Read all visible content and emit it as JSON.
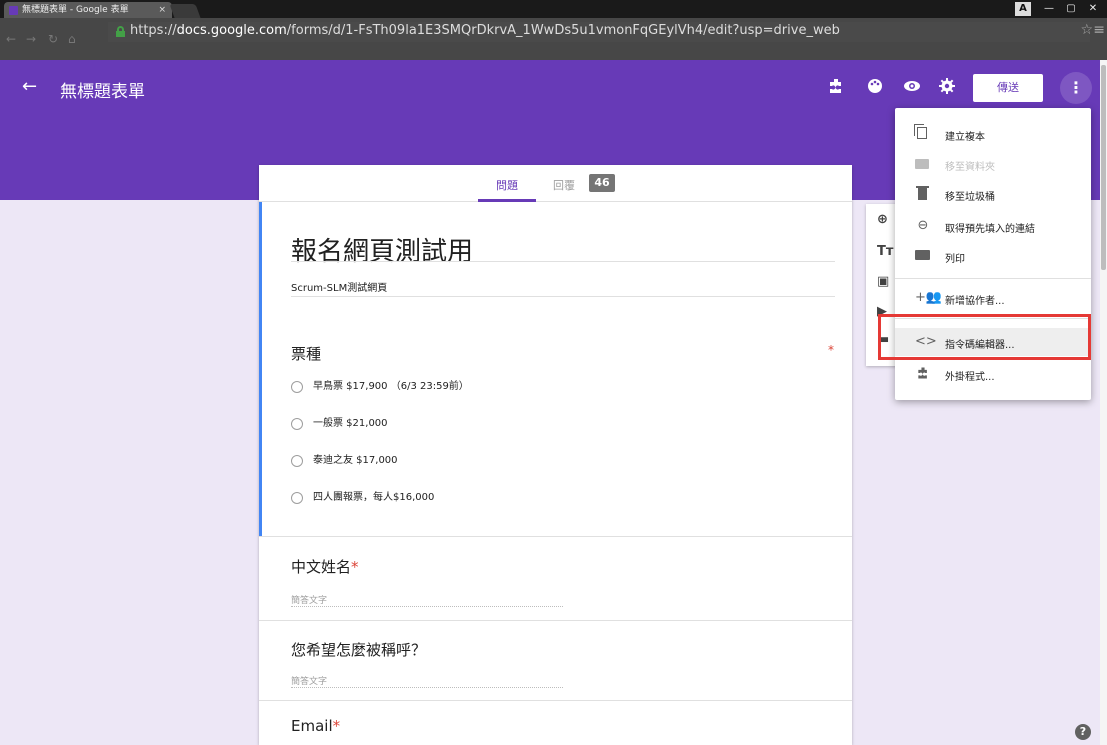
{
  "browser": {
    "tab_title": "無標題表單 - Google 表單",
    "tab_close": "×",
    "url_scheme": "https://",
    "url_host": "docs.google.com",
    "url_path": "/forms/d/1-FsTh09la1E3SMQrDkrvA_1WwDs5u1vmonFqGEylVh4/edit?usp=drive_web",
    "win_controls": {
      "user": "A",
      "minimize": "—",
      "restore": "▢",
      "close": "✕"
    }
  },
  "header": {
    "back": "←",
    "title": "無標題表單",
    "send_label": "傳送",
    "more": "⋮",
    "icons": [
      "puzzle-icon",
      "palette-icon",
      "eye-icon",
      "gear-icon"
    ]
  },
  "card": {
    "tab_questions": "問題",
    "tab_responses": "回覆",
    "responses_count": "46",
    "form_title": "報名網頁測試用",
    "form_description": "Scrum-SLM測試網頁",
    "questions": [
      {
        "title": "票種",
        "required_mark": "*",
        "options": [
          "早鳥票 $17,900 （6/3 23:59前）",
          "一般票 $21,000",
          "泰迪之友 $17,000",
          "四人團報票，每人$16,000"
        ]
      },
      {
        "title": "中文姓名",
        "required_mark": "*",
        "placeholder": "簡答文字"
      },
      {
        "title": "您希望怎麼被稱呼？",
        "placeholder": "簡答文字"
      },
      {
        "title": "Email",
        "required_mark": "*"
      }
    ]
  },
  "side_tools": [
    "⊕",
    "Tт",
    "▣",
    "▶",
    "▬"
  ],
  "menu": {
    "items": [
      {
        "label": "建立複本",
        "icon": "copy-icon",
        "enabled": true
      },
      {
        "label": "移至資料夾",
        "icon": "folder-icon",
        "enabled": false
      },
      {
        "label": "移至垃圾桶",
        "icon": "trash-icon",
        "enabled": true
      },
      {
        "label": "取得預先填入的連結",
        "icon": "link-icon",
        "enabled": true
      },
      {
        "label": "列印",
        "icon": "print-icon",
        "enabled": true
      },
      {
        "label": "新增協作者...",
        "icon": "add-people-icon",
        "enabled": true
      },
      {
        "label": "指令碼編輯器...",
        "icon": "code-icon",
        "enabled": true,
        "highlighted": true
      },
      {
        "label": "外掛程式...",
        "icon": "puzzle-icon",
        "enabled": true
      }
    ]
  },
  "help": "?",
  "colors": {
    "brand_purple": "#673ab7",
    "background": "#ede7f6",
    "highlight_red": "#e53935",
    "active_bar_blue": "#4285f4"
  }
}
